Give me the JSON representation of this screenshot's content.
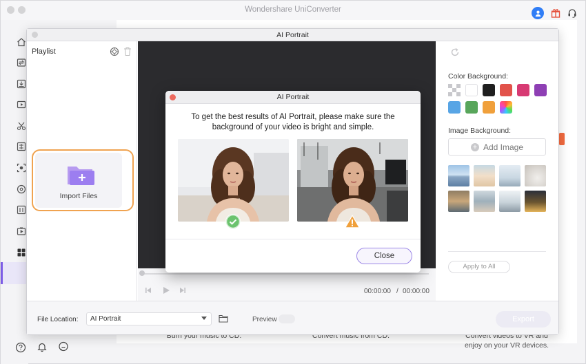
{
  "app": {
    "title": "Wondershare UniConverter",
    "traffic_lights": [
      "close",
      "minimize",
      "zoom"
    ],
    "top_icons": [
      "user-icon",
      "gift-icon",
      "headset-icon"
    ]
  },
  "sidebar": {
    "items": [
      {
        "icon": "home-icon"
      },
      {
        "icon": "convert-icon"
      },
      {
        "icon": "download-icon"
      },
      {
        "icon": "video-editor-icon"
      },
      {
        "icon": "cut-icon"
      },
      {
        "icon": "merge-icon"
      },
      {
        "icon": "screen-recorder-icon"
      },
      {
        "icon": "dvd-burner-icon"
      },
      {
        "icon": "compress-icon"
      },
      {
        "icon": "player-icon"
      },
      {
        "icon": "toolbox-icon"
      }
    ],
    "bottom_icons": [
      "help-icon",
      "bell-icon",
      "feedback-icon"
    ]
  },
  "background": {
    "captions": [
      "Burn your music to CD.",
      "Convert music from CD.",
      "Convert videos to VR and enjoy on your VR devices."
    ]
  },
  "ai_window": {
    "title": "AI Portrait",
    "playlist_title": "Playlist",
    "import_label": "Import Files",
    "time_current": "00:00:00",
    "time_separator": "/",
    "time_total": "00:00:00",
    "color_background_label": "Color Background:",
    "color_swatches": [
      "transparent",
      "#ffffff",
      "#1f1f1f",
      "#e2524a",
      "#d73a73",
      "#8e3fb4",
      "#58a5e5",
      "#58a65b",
      "#f0a03b",
      "rainbow"
    ],
    "image_background_label": "Image Background:",
    "add_image_label": "Add Image",
    "apply_all_label": "Apply to All",
    "file_location_label": "File Location:",
    "file_location_value": "AI Portrait",
    "preview_label": "Preview",
    "export_label": "Export"
  },
  "dialog": {
    "title": "AI Portrait",
    "message_line1": "To get the best results of AI Portrait, please make sure the",
    "message_line2": "background of your video is bright and simple.",
    "good_example_icon": "check-icon",
    "bad_example_icon": "warning-icon",
    "close_label": "Close"
  },
  "colors": {
    "accent": "#7c5ce6",
    "import_ring": "#f0a350",
    "dialog_close_dot": "#ed6a5e",
    "check_green": "#6cc36e",
    "warning_orange": "#f0a03b"
  }
}
